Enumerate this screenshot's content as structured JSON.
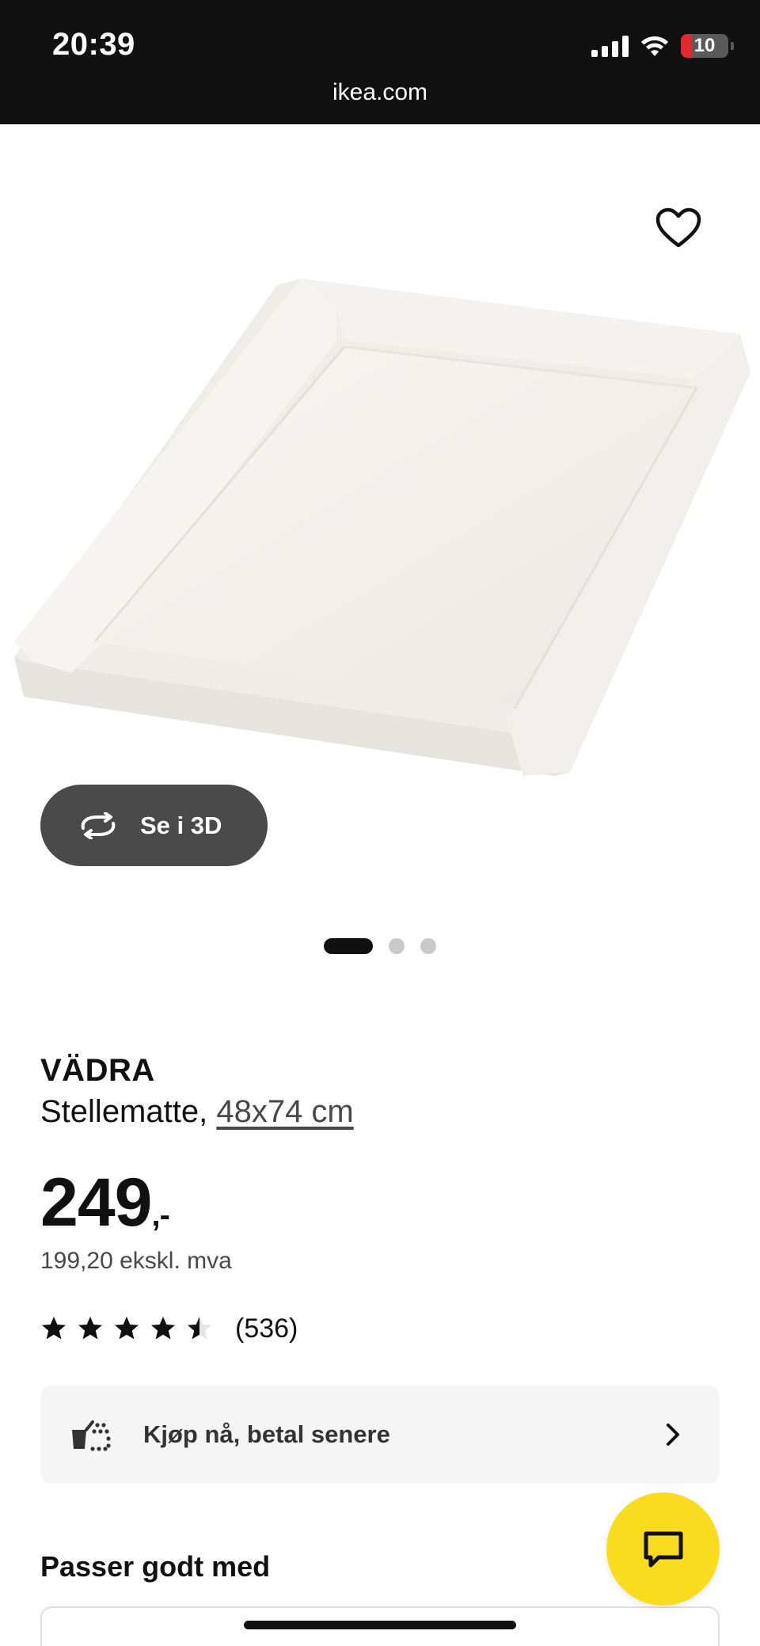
{
  "status_bar": {
    "time": "20:39",
    "battery": "10",
    "url": "ikea.com"
  },
  "hero": {
    "view_3d_label": "Se i 3D",
    "image_dots": 3,
    "active_dot": 0
  },
  "product": {
    "brand": "VÄDRA",
    "type": "Stellematte, ",
    "size": "48x74 cm",
    "price": "249",
    "price_suffix": ",-",
    "price_ex_vat": "199,20 ekskl. mva",
    "rating": 4.5,
    "rating_max": 5,
    "review_count": "(536)"
  },
  "payment": {
    "label": "Kjøp nå, betal senere"
  },
  "section": {
    "title": "Passer godt med"
  },
  "colors": {
    "accent_yellow": "#fadc1e",
    "status_bar": "#111111",
    "button_dark": "#4a4a4a"
  }
}
